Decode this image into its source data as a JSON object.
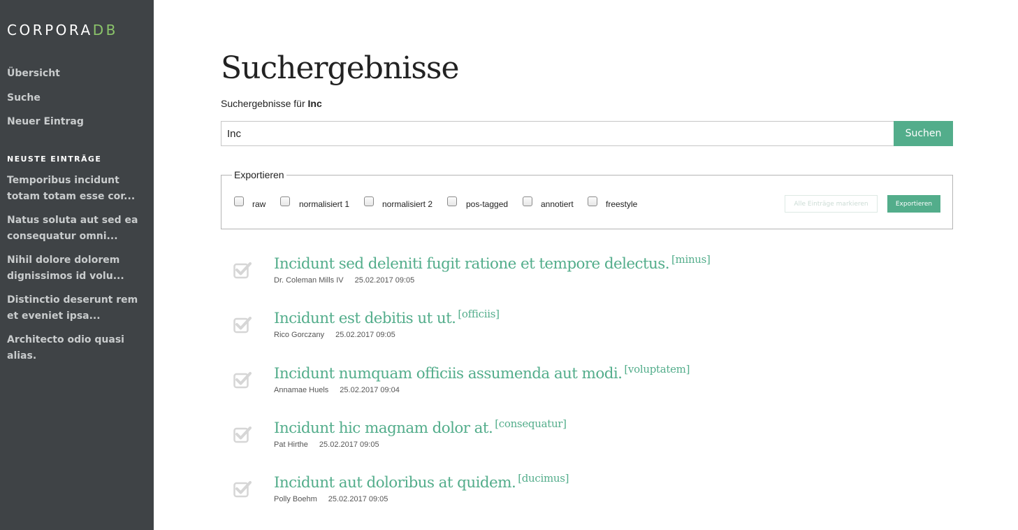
{
  "sidebar": {
    "logo_main": "CORPORA",
    "logo_accent": "DB",
    "nav": [
      {
        "label": "Übersicht"
      },
      {
        "label": "Suche"
      },
      {
        "label": "Neuer Eintrag"
      }
    ],
    "recent_heading": "NEUSTE EINTRÄGE",
    "recent": [
      {
        "label": "Temporibus incidunt totam totam esse cor..."
      },
      {
        "label": "Natus soluta aut sed ea consequatur omni..."
      },
      {
        "label": "Nihil dolore dolorem dignissimos id volu..."
      },
      {
        "label": "Distinctio deserunt rem et eveniet ipsa..."
      },
      {
        "label": "Architecto odio quasi alias."
      }
    ]
  },
  "main": {
    "title": "Suchergebnisse",
    "subtitle_prefix": "Suchergebnisse für",
    "subtitle_query": "Inc",
    "search": {
      "value": "Inc",
      "button_label": "Suchen"
    },
    "export": {
      "legend": "Exportieren",
      "options": [
        {
          "label": "raw"
        },
        {
          "label": "normalisiert 1"
        },
        {
          "label": "normalisiert 2"
        },
        {
          "label": "pos-tagged"
        },
        {
          "label": "annotiert"
        },
        {
          "label": "freestyle"
        }
      ],
      "mark_all_label": "Alle Einträge markieren",
      "export_label": "Exportieren"
    },
    "results": [
      {
        "title": "Incidunt sed deleniti fugit ratione et tempore delectus.",
        "tag": "[minus]",
        "author": "Dr. Coleman Mills IV",
        "date": "25.02.2017 09:05"
      },
      {
        "title": "Incidunt est debitis ut ut.",
        "tag": "[officiis]",
        "author": "Rico Gorczany",
        "date": "25.02.2017 09:05"
      },
      {
        "title": "Incidunt numquam officiis assumenda aut modi.",
        "tag": "[voluptatem]",
        "author": "Annamae Huels",
        "date": "25.02.2017 09:04"
      },
      {
        "title": "Incidunt hic magnam dolor at.",
        "tag": "[consequatur]",
        "author": "Pat Hirthe",
        "date": "25.02.2017 09:05"
      },
      {
        "title": "Incidunt aut doloribus at quidem.",
        "tag": "[ducimus]",
        "author": "Polly Boehm",
        "date": "25.02.2017 09:05"
      }
    ]
  },
  "colors": {
    "sidebar_bg": "#3f4346",
    "accent_green": "#53ad8b",
    "logo_accent": "#8bc46a",
    "checkmark": "#d6d6d6"
  },
  "icons": {
    "result_check": "checkbox-check-icon"
  }
}
